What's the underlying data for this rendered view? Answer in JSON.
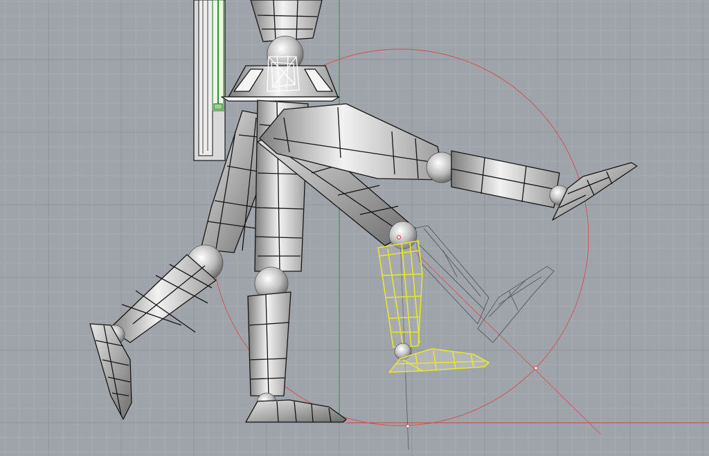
{
  "viewport": {
    "background": "#9fa4ab",
    "grid_minor_color": "#a6abb2",
    "grid_major_color": "#8f949b",
    "axis_y_color": "#2e8f3a",
    "axis_x_color": "#c4443c",
    "selection_color": "#e8e62a",
    "manipulator_color": "#d94a4a"
  },
  "model": {
    "parts": [
      "torso",
      "hips",
      "upper-leg",
      "lower-leg",
      "foot",
      "knee-joint",
      "ankle-joint",
      "hip-joint"
    ]
  }
}
